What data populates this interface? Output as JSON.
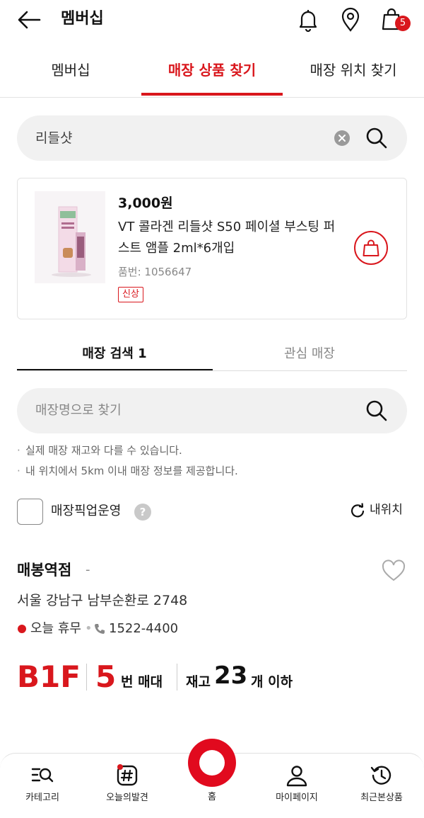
{
  "header": {
    "title": "멤버십",
    "cart_count": "5",
    "icons": [
      "back-arrow-icon",
      "bell-icon",
      "location-pin-icon",
      "shopping-bag-icon"
    ]
  },
  "tabs": [
    {
      "label": "멤버십",
      "active": false
    },
    {
      "label": "매장 상품 찾기",
      "active": true
    },
    {
      "label": "매장 위치 찾기",
      "active": false
    }
  ],
  "search": {
    "value": "리들샷"
  },
  "product": {
    "price": "3,000원",
    "name": "VT 콜라겐 리들샷 S50 페이셜 부스팅 퍼스트 앰플 2ml*6개입",
    "code": "품번: 1056647",
    "badge": "신상"
  },
  "store_tabs": [
    {
      "label": "매장 검색 1",
      "active": true
    },
    {
      "label": "관심 매장",
      "active": false
    }
  ],
  "store_search": {
    "placeholder": "매장명으로 찾기"
  },
  "notes": [
    "실제 매장 재고와 다를 수 있습니다.",
    "내 위치에서 5km 이내 매장 정보를 제공합니다."
  ],
  "filters": {
    "pickup_label": "매장픽업운영",
    "help": "?",
    "my_location": "내위치"
  },
  "store": {
    "name": "매봉역점",
    "dash": "-",
    "address": "서울 강남구 남부순환로 2748",
    "status": "오늘 휴무",
    "separator": "•",
    "phone": "1522-4400",
    "floor": "B1F",
    "shelf_number": "5",
    "shelf_suffix": "번 매대",
    "stock_prefix": "재고",
    "stock_count": "23",
    "stock_suffix": "개 이하"
  },
  "bottom_nav": [
    {
      "label": "카테고리",
      "icon": "category-search-icon"
    },
    {
      "label": "오늘의발견",
      "icon": "hashtag-icon"
    },
    {
      "label": "홈",
      "icon": "home-logo-icon"
    },
    {
      "label": "마이페이지",
      "icon": "person-icon"
    },
    {
      "label": "최근본상품",
      "icon": "history-clock-icon"
    }
  ],
  "colors": {
    "accent": "#d9171d",
    "text": "#111111",
    "muted": "#888888",
    "field_bg": "#f1f1f1"
  }
}
